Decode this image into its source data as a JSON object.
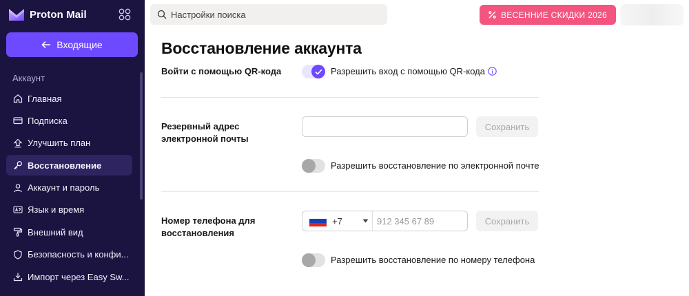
{
  "app": {
    "brand": "Proton Mail",
    "back_label": "Входящие"
  },
  "sidebar": {
    "section_label": "Аккаунт",
    "items": [
      {
        "label": "Главная",
        "icon": "home-icon"
      },
      {
        "label": "Подписка",
        "icon": "card-icon"
      },
      {
        "label": "Улучшить план",
        "icon": "upgrade-icon"
      },
      {
        "label": "Восстановление",
        "icon": "key-icon",
        "active": true
      },
      {
        "label": "Аккаунт и пароль",
        "icon": "user-icon"
      },
      {
        "label": "Язык и время",
        "icon": "language-icon"
      },
      {
        "label": "Внешний вид",
        "icon": "paint-roller-icon"
      },
      {
        "label": "Безопасность и конфи...",
        "icon": "shield-icon"
      },
      {
        "label": "Импорт через Easy Sw...",
        "icon": "import-icon"
      }
    ]
  },
  "topbar": {
    "search_placeholder": "Настройки поиска",
    "promo_label": "ВЕСЕННИЕ СКИДКИ 2026"
  },
  "main": {
    "title": "Восстановление аккаунта",
    "qr": {
      "label": "Войти с помощью QR-кода",
      "toggle_text": "Разрешить вход с помощью QR-кода",
      "enabled": true
    },
    "email": {
      "label": "Резервный адрес электронной почты",
      "value": "",
      "save_label": "Сохранить",
      "toggle_text": "Разрешить восстановление по электронной почте",
      "enabled": false
    },
    "phone": {
      "label": "Номер телефона для восстановления",
      "country_code": "+7",
      "placeholder": "912 345 67 89",
      "save_label": "Сохранить",
      "toggle_text": "Разрешить восстановление по номеру телефона",
      "enabled": false
    }
  },
  "colors": {
    "sidebar_bg": "#1b1340",
    "accent": "#6d4aff",
    "promo": "#f35580"
  }
}
